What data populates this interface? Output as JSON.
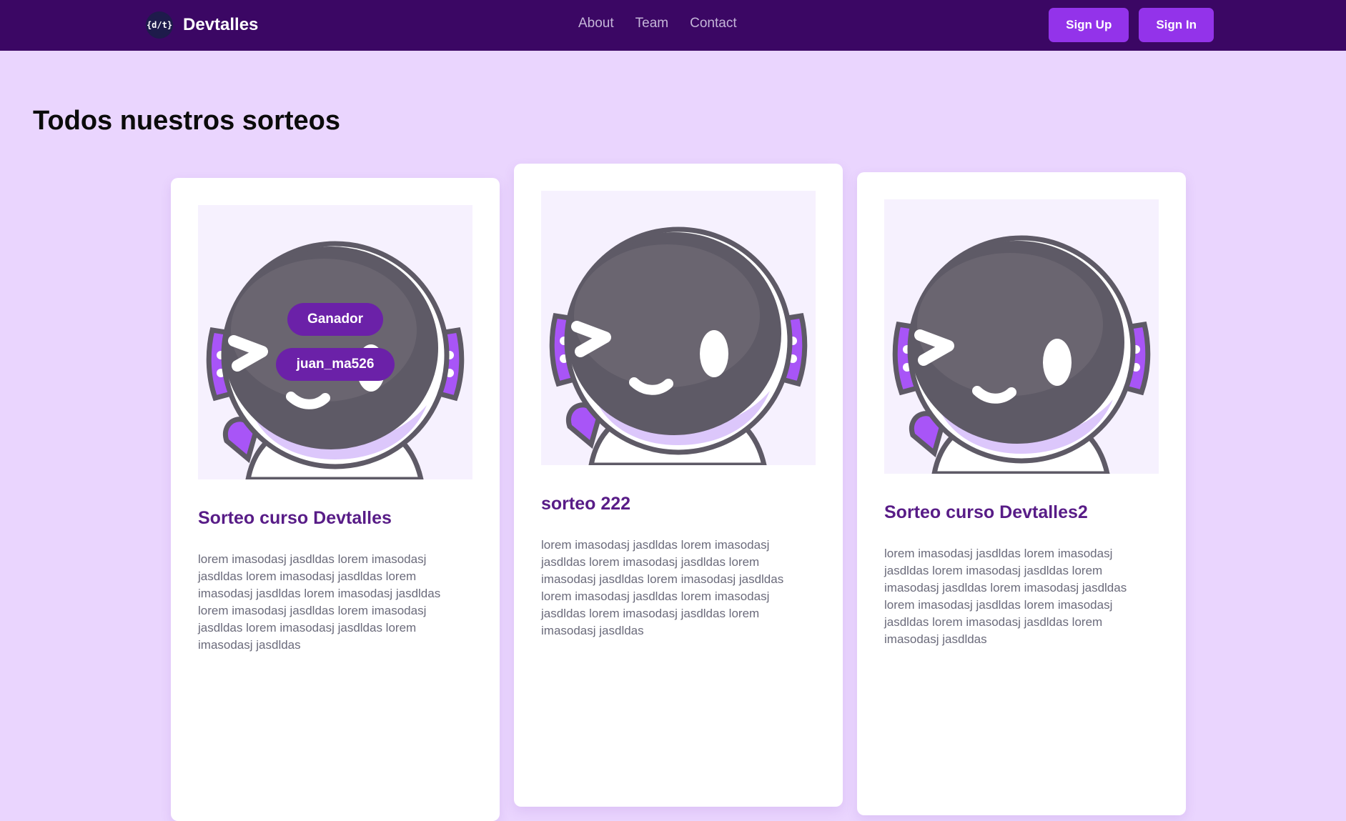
{
  "header": {
    "logo_text": "{d/t}",
    "brand": "Devtalles",
    "nav": [
      {
        "label": "About"
      },
      {
        "label": "Team"
      },
      {
        "label": "Contact"
      }
    ],
    "sign_up": "Sign Up",
    "sign_in": "Sign In"
  },
  "main": {
    "title": "Todos nuestros sorteos",
    "cards": [
      {
        "title": "Sorteo curso Devtalles",
        "description": "lorem imasodasj jasdldas lorem imasodasj jasdldas lorem imasodasj jasdldas lorem imasodasj jasdldas lorem imasodasj jasdldas lorem imasodasj jasdldas lorem imasodasj jasdldas lorem imasodasj jasdldas lorem imasodasj jasdldas",
        "winner_label": "Ganador",
        "winner_name": "juan_ma526"
      },
      {
        "title": "sorteo 222",
        "description": "lorem imasodasj jasdldas lorem imasodasj jasdldas lorem imasodasj jasdldas lorem imasodasj jasdldas lorem imasodasj jasdldas lorem imasodasj jasdldas lorem imasodasj jasdldas lorem imasodasj jasdldas lorem imasodasj jasdldas"
      },
      {
        "title": "Sorteo curso Devtalles2",
        "description": "lorem imasodasj jasdldas lorem imasodasj jasdldas lorem imasodasj jasdldas lorem imasodasj jasdldas lorem imasodasj jasdldas lorem imasodasj jasdldas lorem imasodasj jasdldas lorem imasodasj jasdldas lorem imasodasj jasdldas"
      }
    ]
  },
  "colors": {
    "navbar_bg": "#3b0764",
    "page_bg": "#ead5fe",
    "accent_button": "#9333ea",
    "card_title": "#581c87",
    "winner_pill": "#6b21a8"
  },
  "icons": [
    "devtalles-logo-icon",
    "astronaut-mascot-image"
  ]
}
